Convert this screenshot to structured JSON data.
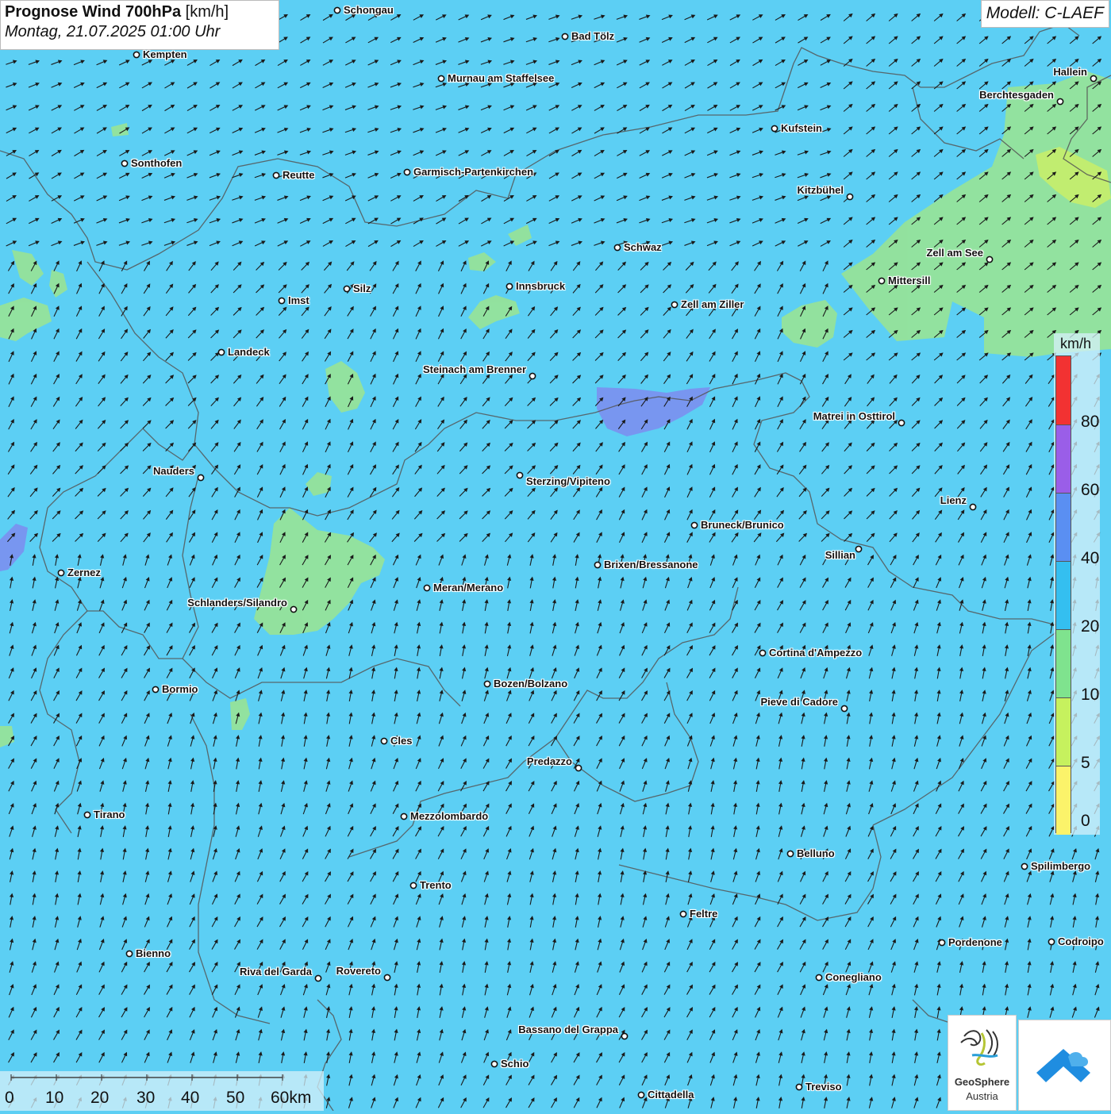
{
  "header": {
    "title_bold": "Prognose Wind 700hPa",
    "title_unit": "[km/h]",
    "date": "Montag, 21.07.2025 01:00 Uhr",
    "model": "Modell: C-LAEF"
  },
  "legend": {
    "unit": "km/h",
    "labels": [
      "80",
      "60",
      "40",
      "20",
      "10",
      "5",
      "0"
    ],
    "colors": [
      "#f23232",
      "#9a5ee8",
      "#5a8ff2",
      "#34bff0",
      "#7fe38e",
      "#c6f15e",
      "#fbf36a"
    ]
  },
  "scale": {
    "labels": [
      "0",
      "10",
      "20",
      "30",
      "40",
      "50",
      "60km"
    ]
  },
  "branding": {
    "geosphere_line1": "GeoSphere",
    "geosphere_line2": "Austria"
  },
  "cities": [
    {
      "name": "Schongau"
    },
    {
      "name": "Bad Tölz"
    },
    {
      "name": "Kempten"
    },
    {
      "name": "Murnau am Staffelsee"
    },
    {
      "name": "Hallein"
    },
    {
      "name": "Berchtesgaden"
    },
    {
      "name": "Kufstein"
    },
    {
      "name": "Sonthofen"
    },
    {
      "name": "Reutte"
    },
    {
      "name": "Garmisch-Partenkirchen"
    },
    {
      "name": "Kitzbühel"
    },
    {
      "name": "Schwaz"
    },
    {
      "name": "Zell am See"
    },
    {
      "name": "Mittersill"
    },
    {
      "name": "Imst"
    },
    {
      "name": "Silz"
    },
    {
      "name": "Innsbruck"
    },
    {
      "name": "Zell am Ziller"
    },
    {
      "name": "Landeck"
    },
    {
      "name": "Steinach am Brenner"
    },
    {
      "name": "Matrei in Osttirol"
    },
    {
      "name": "Nauders"
    },
    {
      "name": "Sterzing/Vipiteno"
    },
    {
      "name": "Lienz"
    },
    {
      "name": "Bruneck/Brunico"
    },
    {
      "name": "Sillian"
    },
    {
      "name": "Zernez"
    },
    {
      "name": "Brixen/Bressanone"
    },
    {
      "name": "Meran/Merano"
    },
    {
      "name": "Schlanders/Silandro"
    },
    {
      "name": "Cortina d'Ampezzo"
    },
    {
      "name": "Bormio"
    },
    {
      "name": "Bozen/Bolzano"
    },
    {
      "name": "Pieve di Cadore"
    },
    {
      "name": "Cles"
    },
    {
      "name": "Predazzo"
    },
    {
      "name": "Tirano"
    },
    {
      "name": "Mezzolombardo"
    },
    {
      "name": "Belluno"
    },
    {
      "name": "Spilimbergo"
    },
    {
      "name": "Trento"
    },
    {
      "name": "Feltre"
    },
    {
      "name": "Pordenone"
    },
    {
      "name": "Codroipo"
    },
    {
      "name": "Bienno"
    },
    {
      "name": "Riva del Garda"
    },
    {
      "name": "Rovereto"
    },
    {
      "name": "Conegliano"
    },
    {
      "name": "Bassano del Grappa"
    },
    {
      "name": "Schio"
    },
    {
      "name": "Treviso"
    },
    {
      "name": "Cittadella"
    }
  ]
}
